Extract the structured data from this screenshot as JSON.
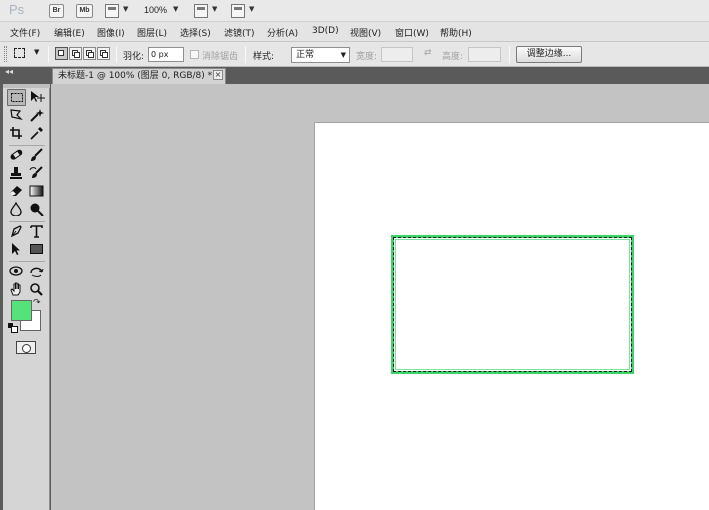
{
  "app": {
    "logo": "Ps",
    "bridge_label": "Br",
    "minibridge_label": "Mb",
    "zoom": "100%"
  },
  "menu": [
    "文件(F)",
    "编辑(E)",
    "图像(I)",
    "图层(L)",
    "选择(S)",
    "滤镜(T)",
    "分析(A)",
    "3D(D)",
    "视图(V)",
    "窗口(W)",
    "帮助(H)"
  ],
  "options": {
    "feather_label": "羽化:",
    "feather_value": "0 px",
    "antialias_label": "消除锯齿",
    "style_label": "样式:",
    "style_value": "正常",
    "width_label": "宽度:",
    "height_label": "高度:",
    "refine_edge_label": "调整边缘..."
  },
  "document": {
    "tab_title": "未标题-1 @ 100% (图层 0, RGB/8) *",
    "close_glyph": "×"
  },
  "colors": {
    "foreground": "#55e27a",
    "background": "#ffffff",
    "selection_stroke": "#3ed26b"
  },
  "tools": [
    "rectangular-marquee",
    "move",
    "quick-mask-lasso",
    "magic-wand",
    "crop",
    "eyedropper",
    "spot-healing-brush",
    "brush",
    "clone-stamp",
    "history-brush",
    "eraser",
    "gradient",
    "blur",
    "dodge",
    "pen",
    "type",
    "path-selection",
    "rectangle-shape",
    "3d-rotate",
    "3d-orbit",
    "hand",
    "zoom"
  ]
}
